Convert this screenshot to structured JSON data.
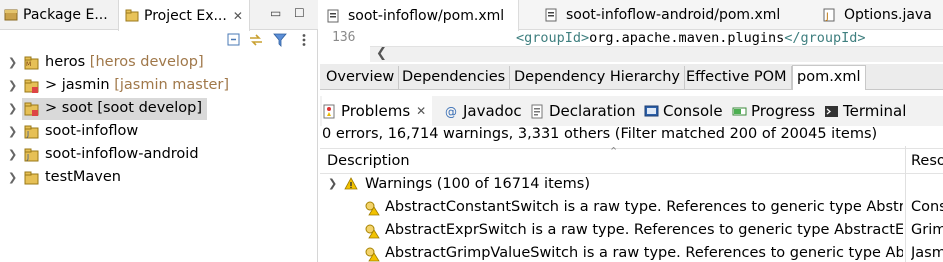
{
  "left_panel": {
    "tabs": [
      {
        "label": "Package E...",
        "active": false
      },
      {
        "label": "Project Ex...",
        "active": true
      }
    ],
    "tree": [
      {
        "name": "heros",
        "branch": "[heros develop]",
        "expanded": false,
        "selected": false
      },
      {
        "name": "> jasmin",
        "branch": "[jasmin master]",
        "expanded": false,
        "selected": false
      },
      {
        "name": "> soot [soot develop]",
        "branch": "",
        "expanded": false,
        "selected": true
      },
      {
        "name": "soot-infoflow",
        "branch": "",
        "expanded": false,
        "selected": false
      },
      {
        "name": "soot-infoflow-android",
        "branch": "",
        "expanded": false,
        "selected": false
      },
      {
        "name": "testMaven",
        "branch": "",
        "expanded": false,
        "selected": false
      }
    ]
  },
  "editor": {
    "tabs": [
      {
        "label": "soot-infoflow/pom.xml",
        "active": true
      },
      {
        "label": "soot-infoflow-android/pom.xml",
        "active": false
      },
      {
        "label": "Options.java",
        "active": false
      }
    ],
    "line_number": "136",
    "code": {
      "open_tag": "<groupId>",
      "text": "org.apache.maven.plugins",
      "close_tag": "</groupId>"
    },
    "pom_tabs": [
      "Overview",
      "Dependencies",
      "Dependency Hierarchy",
      "Effective POM",
      "pom.xml"
    ],
    "pom_active": "pom.xml"
  },
  "views": {
    "tabs": [
      {
        "label": "Problems",
        "icon": "problems-icon",
        "active": true
      },
      {
        "label": "Javadoc",
        "icon": "javadoc-icon",
        "active": false
      },
      {
        "label": "Declaration",
        "icon": "declaration-icon",
        "active": false
      },
      {
        "label": "Console",
        "icon": "console-icon",
        "active": false
      },
      {
        "label": "Progress",
        "icon": "progress-icon",
        "active": false
      },
      {
        "label": "Terminal",
        "icon": "terminal-icon",
        "active": false
      }
    ],
    "summary": "0 errors, 16,714 warnings, 3,331 others (Filter matched 200 of 20045 items)"
  },
  "problems_table": {
    "columns": [
      "Description",
      "Reso"
    ],
    "group": "Warnings (100 of 16714 items)",
    "rows": [
      {
        "description": "AbstractConstantSwitch is a raw type. References to generic type Abstra",
        "resource": "Cons"
      },
      {
        "description": "AbstractExprSwitch is a raw type. References to generic type AbstractEx",
        "resource": "Grim"
      },
      {
        "description": "AbstractGrimpValueSwitch is a raw type. References to generic type Ab",
        "resource": "Jasm"
      }
    ]
  },
  "colors": {
    "branch_text": "#a0784a",
    "selection": "#d9d9d9",
    "xml_tag": "#3f7f7f",
    "warning": "#e8b800"
  }
}
